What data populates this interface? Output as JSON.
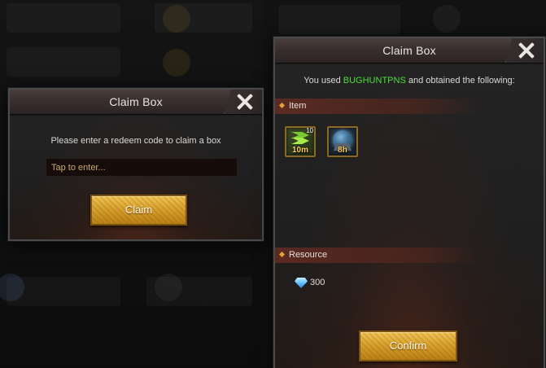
{
  "claim_dialog": {
    "title": "Claim Box",
    "prompt": "Please enter a redeem code to claim a box",
    "code_input_placeholder": "Tap to enter...",
    "claim_label": "Claim"
  },
  "result_dialog": {
    "title": "Claim Box",
    "used_prefix": "You used ",
    "redeem_code": "BUGHUNTPNS",
    "used_suffix": " and obtained the following:",
    "items_section_label": "Item",
    "items": [
      {
        "icon": "speedup-icon",
        "time": "10m",
        "count": "10"
      },
      {
        "icon": "shield-icon",
        "time": "8h"
      }
    ],
    "resource_section_label": "Resource",
    "resources": [
      {
        "icon": "gem-icon",
        "value": "300"
      }
    ],
    "confirm_label": "Confirm"
  },
  "colors": {
    "accent_gold": "#d9a22e",
    "code_green": "#4fdc3c",
    "item_time_yellow": "#ffd35a"
  }
}
